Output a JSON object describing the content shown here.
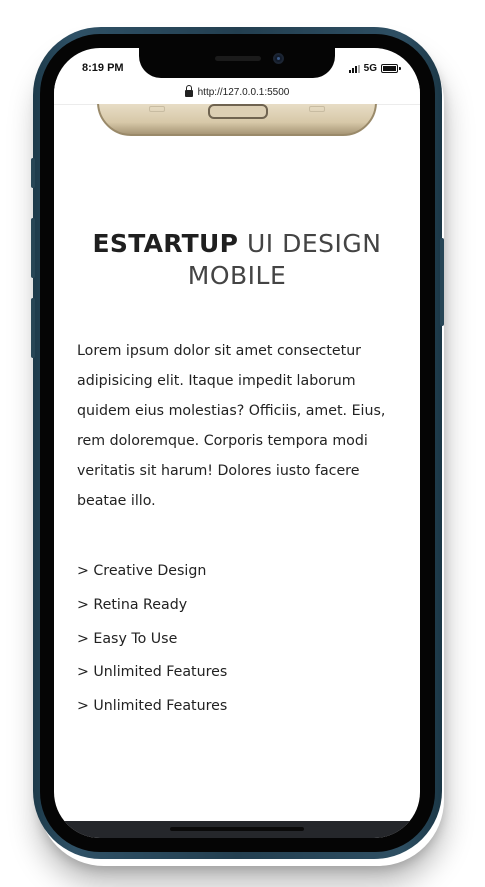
{
  "status_bar": {
    "time": "8:19 PM",
    "network": "5G"
  },
  "browser": {
    "url": "http://127.0.0.1:5500"
  },
  "hero": {
    "title_bold": "ESTARTUP",
    "title_light": "UI DESIGN MOBILE"
  },
  "description": "Lorem ipsum dolor sit amet consectetur adipisicing elit. Itaque impedit laborum quidem eius molestias? Officiis, amet. Eius, rem doloremque. Corporis tempora modi veritatis sit harum! Dolores iusto facere beatae illo.",
  "features": [
    "> Creative Design",
    "> Retina Ready",
    "> Easy To Use",
    "> Unlimited Features",
    "> Unlimited Features"
  ],
  "colors": {
    "phone_frame": "#2f5166",
    "bezel": "#050505",
    "footer": "#25272b",
    "text": "#222222"
  }
}
